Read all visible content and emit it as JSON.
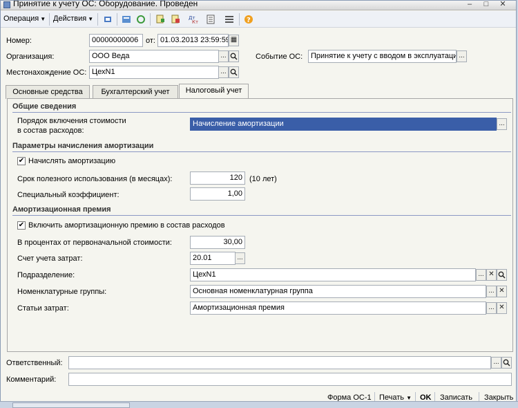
{
  "window": {
    "title": "Принятие к учету ОС: Оборудование. Проведен"
  },
  "toolbar": {
    "operation_label": "Операция",
    "actions_label": "Действия",
    "icons": [
      "post-icon",
      "structure-icon",
      "movements-icon",
      "copy-icon",
      "paste-icon",
      "dt-kt-icon",
      "report-icon",
      "list-icon",
      "help-icon"
    ]
  },
  "header": {
    "number_label": "Номер:",
    "number_value": "00000000006",
    "from_label": "от:",
    "date_value": "01.03.2013 23:59:59",
    "org_label": "Организация:",
    "org_value": "ООО Веда",
    "event_label": "Событие ОС:",
    "event_value": "Принятие к учету с вводом в эксплуатаци",
    "location_label": "Местонахождение ОС:",
    "location_value": "ЦехN1"
  },
  "tabs": [
    {
      "label": "Основные средства"
    },
    {
      "label": "Бухгалтерский учет"
    },
    {
      "label": "Налоговый учет"
    }
  ],
  "general": {
    "title": "Общие сведения",
    "order_label_line1": "Порядок включения стоимости",
    "order_label_line2": "в состав расходов:",
    "order_value": "Начисление амортизации"
  },
  "depreciation": {
    "title": "Параметры начисления амортизации",
    "charge_label": "Начислять амортизацию",
    "life_label": "Срок полезного использования (в месяцах):",
    "life_value": "120",
    "life_hint": "(10 лет)",
    "coef_label": "Специальный коэффициент:",
    "coef_value": "1,00"
  },
  "bonus": {
    "title": "Амортизационная премия",
    "include_label": "Включить амортизационную премию в состав расходов",
    "percent_label": "В процентах от первоначальной стоимости:",
    "percent_value": "30,00",
    "account_label": "Счет учета затрат:",
    "account_value": "20.01",
    "department_label": "Подразделение:",
    "department_value": "ЦехN1",
    "nomenclature_label": "Номенклатурные группы:",
    "nomenclature_value": "Основная номенклатурная группа",
    "cost_item_label": "Статьи затрат:",
    "cost_item_value": "Амортизационная премия"
  },
  "bottom": {
    "responsible_label": "Ответственный:",
    "comment_label": "Комментарий:"
  },
  "footer": {
    "form_label": "Форма ОС-1",
    "print_label": "Печать",
    "ok_label": "OK",
    "save_label": "Записать",
    "close_label": "Закрыть"
  },
  "glyphs": {
    "ellipsis": "...",
    "search": "🔍",
    "clear": "✕",
    "check": "✔",
    "dropdown": "▾"
  }
}
